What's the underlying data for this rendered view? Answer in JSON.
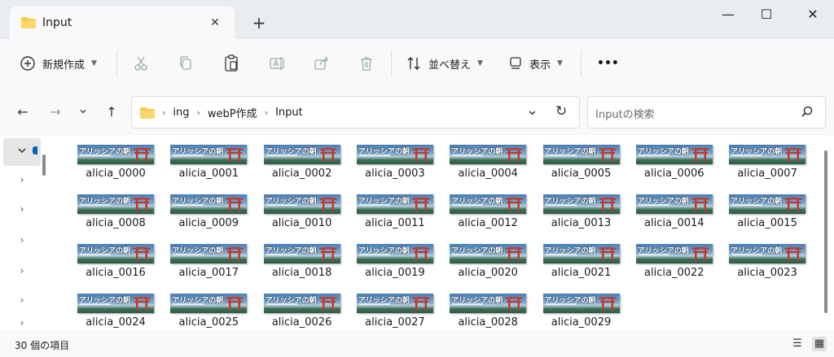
{
  "window": {
    "tab_title": "Input",
    "close_tab": "✕",
    "new_tab": "+",
    "minimize": "—",
    "maximize": "☐",
    "close": "✕"
  },
  "toolbar": {
    "new_label": "新規作成",
    "sort_label": "並べ替え",
    "view_label": "表示",
    "more": "•••"
  },
  "nav": {
    "back": "←",
    "forward": "→",
    "recent": "⌄",
    "up": "↑"
  },
  "address": {
    "crumbs": [
      "ing",
      "webP作成",
      "Input"
    ],
    "dropdown": "⌄",
    "refresh": "↻"
  },
  "search": {
    "placeholder": "Inputの検索"
  },
  "thumbnail": {
    "title": "アリッシアの朝"
  },
  "files": [
    "alicia_0000",
    "alicia_0001",
    "alicia_0002",
    "alicia_0003",
    "alicia_0004",
    "alicia_0005",
    "alicia_0006",
    "alicia_0007",
    "alicia_0008",
    "alicia_0009",
    "alicia_0010",
    "alicia_0011",
    "alicia_0012",
    "alicia_0013",
    "alicia_0014",
    "alicia_0015",
    "alicia_0016",
    "alicia_0017",
    "alicia_0018",
    "alicia_0019",
    "alicia_0020",
    "alicia_0021",
    "alicia_0022",
    "alicia_0023",
    "alicia_0024",
    "alicia_0025",
    "alicia_0026",
    "alicia_0027",
    "alicia_0028",
    "alicia_0029"
  ],
  "status": {
    "count": "30 個の項目"
  },
  "colors": {
    "accent": "#0067c0",
    "folder": "#f8c74a",
    "torii": "#c0392b"
  }
}
